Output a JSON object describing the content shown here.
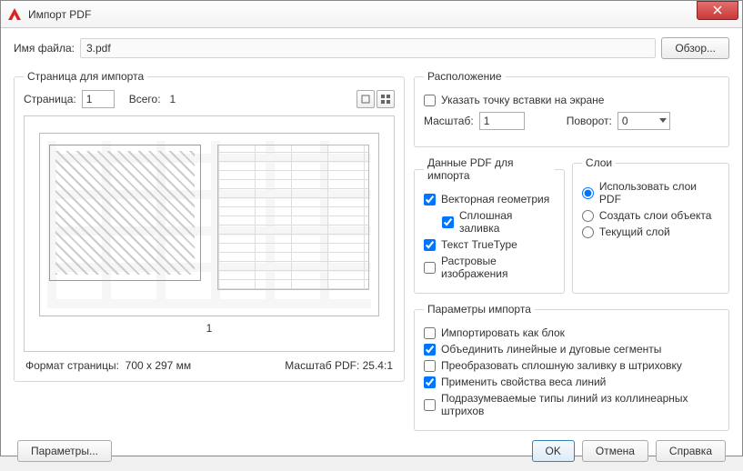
{
  "window": {
    "title": "Импорт PDF"
  },
  "file": {
    "label": "Имя файла:",
    "name": "3.pdf",
    "browse": "Обзор..."
  },
  "pageImport": {
    "legend": "Страница для импорта",
    "pageLabel": "Страница:",
    "pageValue": "1",
    "totalLabel": "Всего:",
    "totalValue": "1",
    "currentPage": "1",
    "formatLabel": "Формат страницы:",
    "formatValue": "700 x  297 мм",
    "scaleLabel": "Масштаб PDF:",
    "scaleValue": "25.4:1"
  },
  "location": {
    "legend": "Расположение",
    "specifyPoint": "Указать точку вставки на экране",
    "scaleLabel": "Масштаб:",
    "scaleValue": "1",
    "rotationLabel": "Поворот:",
    "rotationValue": "0"
  },
  "pdfData": {
    "legend": "Данные PDF для импорта",
    "vector": "Векторная геометрия",
    "solidFill": "Сплошная заливка",
    "truetype": "Текст TrueType",
    "raster": "Растровые изображения"
  },
  "layers": {
    "legend": "Слои",
    "usePdf": "Использовать слои PDF",
    "createObj": "Создать слои объекта",
    "current": "Текущий слой"
  },
  "importOpts": {
    "legend": "Параметры импорта",
    "asBlock": "Импортировать как блок",
    "joinSegments": "Объединить линейные и дуговые сегменты",
    "convertFill": "Преобразовать сплошную заливку в штриховку",
    "lineWeight": "Применить свойства веса линий",
    "inferLinetypes": "Подразумеваемые типы линий из коллинеарных штрихов"
  },
  "footer": {
    "options": "Параметры...",
    "ok": "OK",
    "cancel": "Отмена",
    "help": "Справка"
  }
}
